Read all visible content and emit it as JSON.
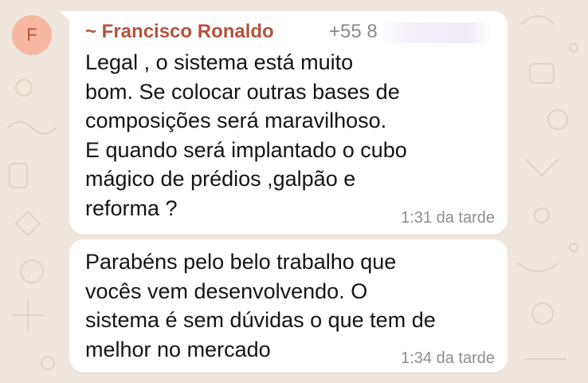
{
  "chat": {
    "avatar": {
      "initial": "F",
      "color": "#f7b7a3"
    },
    "messages": [
      {
        "sender": "~ Francisco Ronaldo",
        "sender_color": "#b5533c",
        "phone": "+55 8",
        "text": "Legal , o sistema está muito\nbom. Se colocar outras bases de\ncomposições será maravilhoso.\nE quando será implantado o cubo\nmágico de prédios ,galpão e\nreforma ?",
        "time": "1:31 da tarde"
      },
      {
        "text": "Parabéns pelo belo trabalho que\nvocês vem desenvolvendo. O\nsistema é sem dúvidas o que tem de\nmelhor no mercado",
        "time": "1:34 da tarde"
      }
    ]
  }
}
